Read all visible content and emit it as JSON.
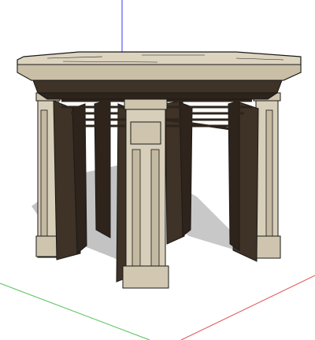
{
  "viewport": {
    "background": "#ffffff",
    "axes": {
      "blue_axis_color": "#3a3aff",
      "red_axis_color": "#e05050",
      "green_axis_color": "#50c050"
    },
    "colors": {
      "stone_light": "#ddd4c0",
      "stone_mid": "#c9bea6",
      "stone_shadow": "#b4a88e",
      "dark_wood": "#3f3226",
      "dark_wood_alt": "#2e241b",
      "ground_shadow": "#bfbfbf",
      "edge": "#1a1a1a"
    }
  }
}
